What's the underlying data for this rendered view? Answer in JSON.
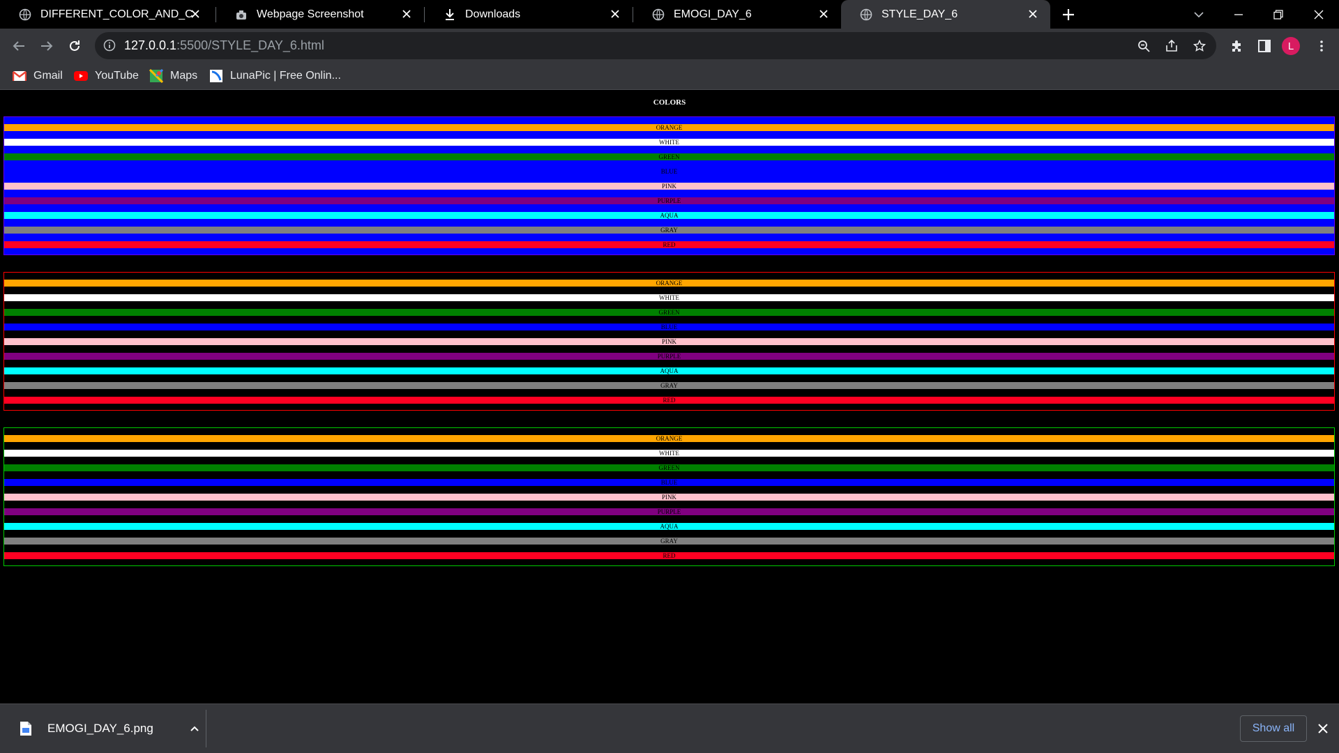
{
  "browser": {
    "tabs": [
      {
        "title": "DIFFERENT_COLOR_AND_CUSTOM",
        "icon": "globe-icon",
        "active": false
      },
      {
        "title": "Webpage Screenshot",
        "icon": "extension-icon",
        "active": false
      },
      {
        "title": "Downloads",
        "icon": "download-icon",
        "active": false
      },
      {
        "title": "EMOGI_DAY_6",
        "icon": "globe-icon",
        "active": false
      },
      {
        "title": "STYLE_DAY_6",
        "icon": "globe-icon",
        "active": true
      }
    ],
    "url_host": "127.0.0.1",
    "url_rest": ":5500/STYLE_DAY_6.html",
    "avatar_letter": "L",
    "bookmarks": [
      {
        "label": "Gmail",
        "icon": "gmail-icon"
      },
      {
        "label": "YouTube",
        "icon": "youtube-icon"
      },
      {
        "label": "Maps",
        "icon": "maps-icon"
      },
      {
        "label": "LunaPic | Free Onlin...",
        "icon": "lunapic-icon"
      }
    ]
  },
  "page": {
    "title": "COLORS",
    "sections": [
      {
        "border": "#6600ff",
        "background": "#0000ff"
      },
      {
        "border": "#ff0000",
        "background": "#000000"
      },
      {
        "border": "#00cc00",
        "background": "#000000"
      }
    ],
    "bands": [
      {
        "label": "ORANGE",
        "color": "#ffa500"
      },
      {
        "label": "WHITE",
        "color": "#ffffff"
      },
      {
        "label": "GREEN",
        "color": "#008000"
      },
      {
        "label": "BLUE",
        "color": "#0000ff"
      },
      {
        "label": "PINK",
        "color": "#ffc0cb"
      },
      {
        "label": "PURPLE",
        "color": "#800080"
      },
      {
        "label": "AQUA",
        "color": "#00ffff"
      },
      {
        "label": "GRAY",
        "color": "#808080"
      },
      {
        "label": "RED",
        "color": "#ff0022"
      }
    ]
  },
  "downloads": {
    "file_name": "EMOGI_DAY_6.png",
    "show_all": "Show all"
  }
}
